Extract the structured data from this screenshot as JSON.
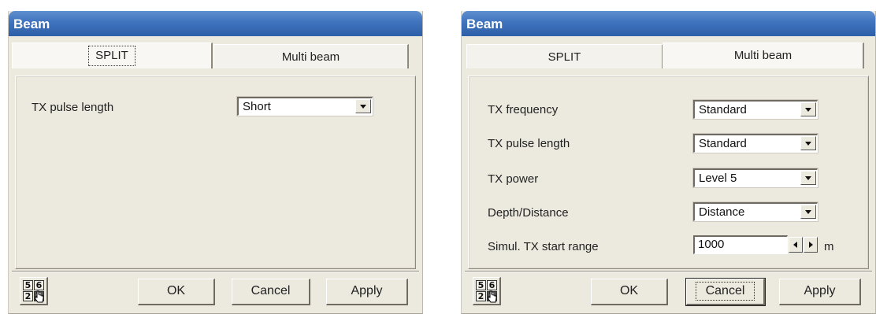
{
  "dialogs": [
    {
      "title": "Beam",
      "tabs": [
        {
          "label": "SPLIT",
          "active": true
        },
        {
          "label": "Multi beam",
          "active": false
        }
      ],
      "rows": [
        {
          "label": "TX pulse length",
          "type": "select",
          "value": "Short"
        }
      ],
      "icon_digits": [
        "5",
        "6",
        "2",
        "9"
      ],
      "buttons": {
        "ok": "OK",
        "cancel": "Cancel",
        "apply": "Apply"
      }
    },
    {
      "title": "Beam",
      "tabs": [
        {
          "label": "SPLIT",
          "active": false
        },
        {
          "label": "Multi beam",
          "active": true
        }
      ],
      "rows": [
        {
          "label": "TX frequency",
          "type": "select",
          "value": "Standard"
        },
        {
          "label": "TX pulse length",
          "type": "select",
          "value": "Standard"
        },
        {
          "label": "TX power",
          "type": "select",
          "value": "Level 5"
        },
        {
          "label": "Depth/Distance",
          "type": "select",
          "value": "Distance"
        },
        {
          "label": "Simul. TX start range",
          "type": "spinner",
          "value": "1000",
          "unit": "m"
        }
      ],
      "icon_digits": [
        "5",
        "6",
        "2",
        "9"
      ],
      "buttons": {
        "ok": "OK",
        "cancel": "Cancel",
        "apply": "Apply"
      }
    }
  ]
}
